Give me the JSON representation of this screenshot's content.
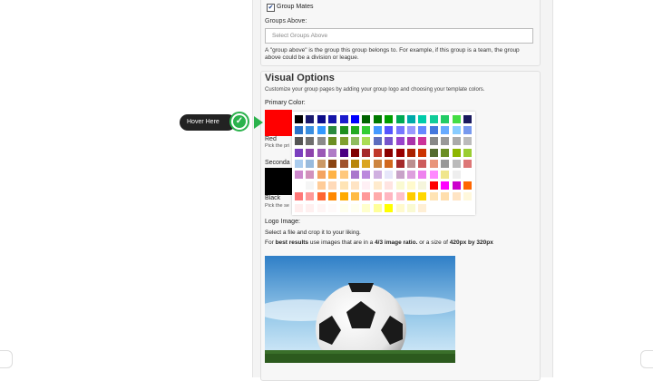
{
  "group_mates": {
    "label": "Group Mates",
    "checked": true
  },
  "groups_above": {
    "label": "Groups Above:",
    "placeholder": "Select Groups Above",
    "help": "A \"group above\" is the group this group belongs to. For example, if this group is a team, the group above could be a division or league."
  },
  "visual_options": {
    "title": "Visual Options",
    "subtitle": "Customize your group pages by adding your group logo and choosing your template colors.",
    "primary": {
      "label": "Primary Color:",
      "color_name": "Red",
      "color_hex": "#ff0000",
      "hint": "Pick the pri"
    },
    "secondary": {
      "label": "Seconda",
      "color_name": "Black",
      "color_hex": "#000000",
      "hint": "Pick the se"
    }
  },
  "tooltip": {
    "label": "Hover Here"
  },
  "logo": {
    "label": "Logo Image:",
    "line1": "Select a file and crop it to your liking.",
    "line2_prefix": "For ",
    "line2_bold1": "best results",
    "line2_mid": " use images that are in a ",
    "line2_bold2": "4/3 image ratio.",
    "line2_mid2": " or a size of ",
    "line2_bold3": "420px by 320px",
    "image_caption": "Soccer ball on grass"
  },
  "palette": {
    "rows": [
      [
        "#000000",
        "#1a1a6e",
        "#0d0d8a",
        "#1515a8",
        "#1a1acc",
        "#0000ff",
        "#006400",
        "#007a00",
        "#009e00",
        "#00aa55",
        "#00aaaa",
        "#00ccaa",
        "#11cc99",
        "#22cc66",
        "#44dd44",
        "#1a1a5e"
      ],
      [
        "#2a73c8",
        "#3a8ee0",
        "#3399ff",
        "#2b8a3e",
        "#1e8f1e",
        "#22aa22",
        "#33cc33",
        "#4499ff",
        "#5555ff",
        "#7777ff",
        "#9999ff",
        "#6688ff",
        "#4477dd",
        "#66aaff",
        "#88ccff",
        "#7799ee"
      ],
      [
        "#555555",
        "#6e6e6e",
        "#8a8a8a",
        "#6b8e23",
        "#7f9f2f",
        "#8fbc5f",
        "#aadd55",
        "#5d6dbe",
        "#7755cc",
        "#9944cc",
        "#aa33aa",
        "#cc3399",
        "#888888",
        "#999999",
        "#aaaaaa",
        "#bbbbbb"
      ],
      [
        "#7a3fbf",
        "#8e44ad",
        "#9b59b6",
        "#b07cc6",
        "#4b0082",
        "#800000",
        "#a52a2a",
        "#c0392b",
        "#8b0000",
        "#990000",
        "#aa2200",
        "#cc3300",
        "#556b2f",
        "#6b8e23",
        "#8db600",
        "#9acd32"
      ],
      [
        "#aaccee",
        "#99bbdd",
        "#cc9966",
        "#8b4513",
        "#a0522d",
        "#b8860b",
        "#daa520",
        "#cd853f",
        "#d2691e",
        "#a52a2a",
        "#bc8f8f",
        "#cd5c5c",
        "#e9967a",
        "#999999",
        "#bbbbbb",
        "#dd7777"
      ],
      [
        "#cc88cc",
        "#d291bc",
        "#f4a460",
        "#ffb347",
        "#ffc87c",
        "#aa77cc",
        "#bb88dd",
        "#d0b0e0",
        "#e6e6fa",
        "#c8a2c8",
        "#dda0dd",
        "#ee82ee",
        "#ff88ff",
        "#f0e68c",
        "#eeeeee",
        "#ffffff"
      ],
      [
        "#ffffff",
        "#f5f5f5",
        "#ffcc99",
        "#ffdab9",
        "#ffe4b5",
        "#ffe4c4",
        "#fff0f5",
        "#ffebcd",
        "#ffe4e1",
        "#fafad2",
        "#fffacd",
        "#f5f5dc",
        "#ff0000",
        "#ff00ff",
        "#cc00cc",
        "#ff6600"
      ],
      [
        "#ff7777",
        "#ff9999",
        "#ff6633",
        "#ff8800",
        "#ffaa00",
        "#ffbb44",
        "#ff9999",
        "#ffaaaa",
        "#ffb6c1",
        "#ffc0cb",
        "#ffcc00",
        "#ffd700",
        "#ffe4b5",
        "#ffdead",
        "#ffe4c4",
        "#fff8dc"
      ],
      [
        "#ffeeee",
        "#fff0f0",
        "#fff5f5",
        "#fffafa",
        "#ffffee",
        "#fffff0",
        "#ffffcc",
        "#ffff99",
        "#ffff00",
        "#fffacd",
        "#fafad2",
        "#ffefd5",
        "#ffffff",
        "#ffffff",
        "#ffffff",
        "#ffffff"
      ]
    ]
  }
}
